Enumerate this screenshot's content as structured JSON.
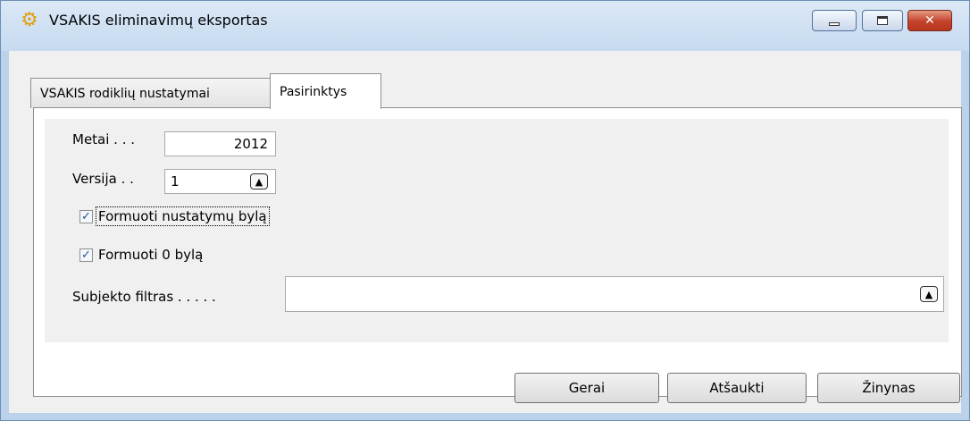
{
  "window": {
    "title": "VSAKIS eliminavimų eksportas",
    "icon": "gear-icon",
    "controls": {
      "minimize": "minimize-icon",
      "maximize": "maximize-icon",
      "close": "✕"
    }
  },
  "tabs": [
    {
      "label": "VSAKIS rodiklių nustatymai",
      "active": false
    },
    {
      "label": "Pasirinktys",
      "active": true
    }
  ],
  "form": {
    "metai": {
      "label": "Metai . . .",
      "value": "2012"
    },
    "versija": {
      "label": "Versija . .",
      "value": "1"
    },
    "checkbox_nustatymu": {
      "label": "Formuoti nustatymų bylą",
      "checked": true
    },
    "checkbox_zero": {
      "label": "Formuoti 0 bylą",
      "checked": true
    },
    "subjekto_filtras": {
      "label": "Subjekto filtras . . . . .",
      "value": ""
    }
  },
  "buttons": {
    "gerai": "Gerai",
    "atsaukti": "Atšaukti",
    "zinynas": "Žinynas"
  }
}
